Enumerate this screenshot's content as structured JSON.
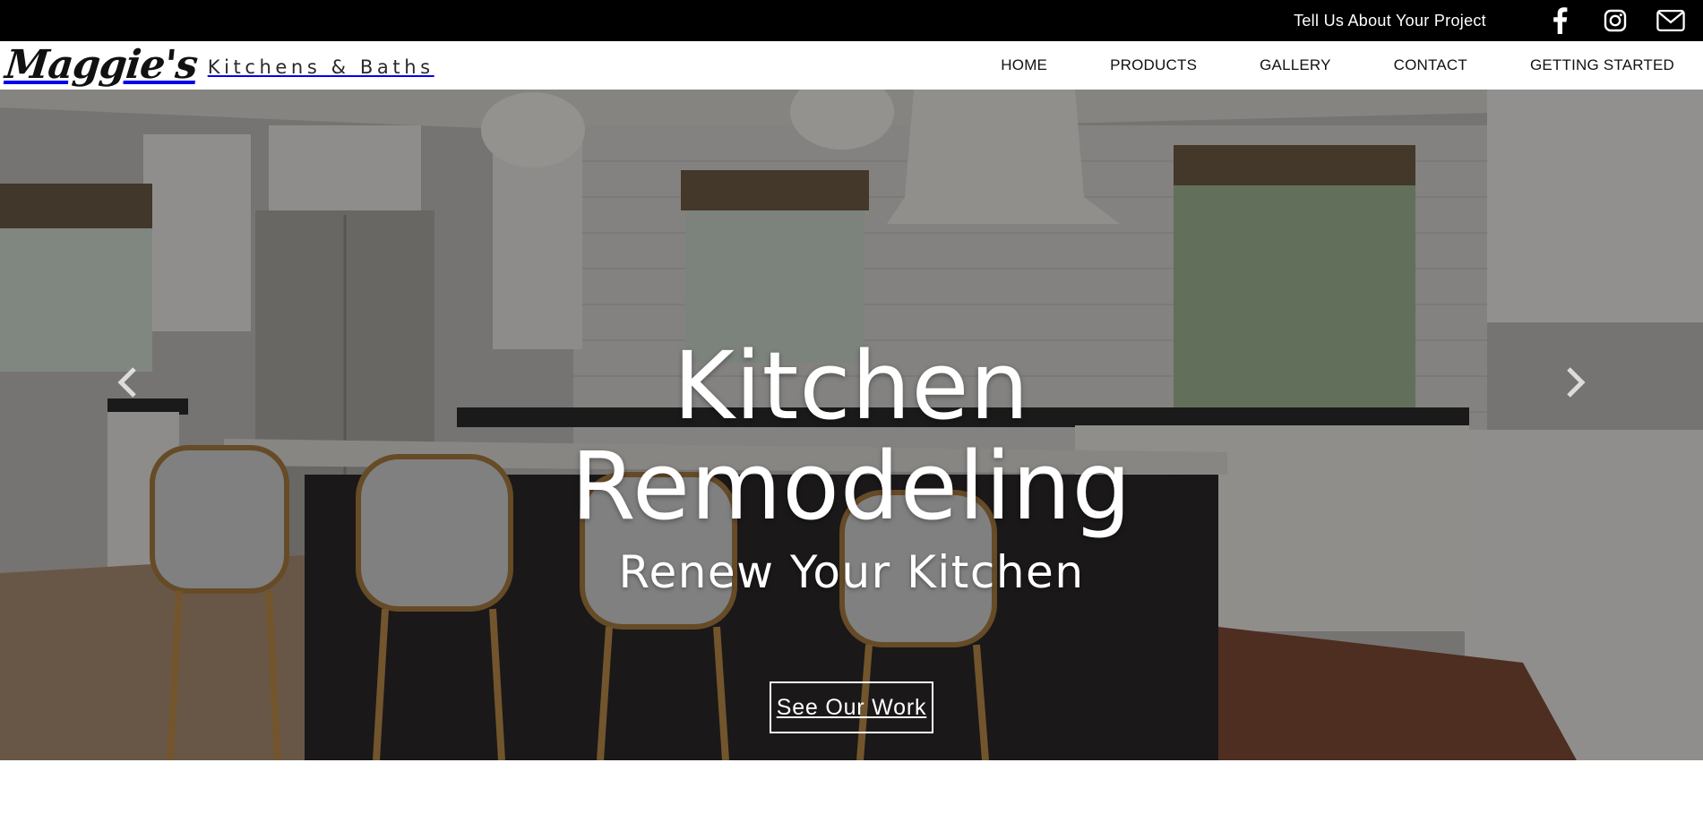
{
  "topbar": {
    "cta_label": "Tell Us About Your Project",
    "social_icons": [
      "facebook-icon",
      "instagram-icon",
      "envelope-icon"
    ]
  },
  "brand": {
    "script": "Maggie's",
    "subtitle": "Kitchens & Baths"
  },
  "nav": {
    "items": [
      {
        "label": "HOME"
      },
      {
        "label": "PRODUCTS"
      },
      {
        "label": "GALLERY"
      },
      {
        "label": "CONTACT"
      },
      {
        "label": "GETTING STARTED"
      }
    ]
  },
  "hero": {
    "title_line1": "Kitchen",
    "title_line2": "Remodeling",
    "subtitle": "Renew Your Kitchen",
    "button_label": "See Our Work",
    "prev_icon": "chevron-left-icon",
    "next_icon": "chevron-right-icon"
  },
  "colors": {
    "topbar_bg": "#000000",
    "nav_bg": "#ffffff",
    "hero_text": "#ffffff"
  }
}
